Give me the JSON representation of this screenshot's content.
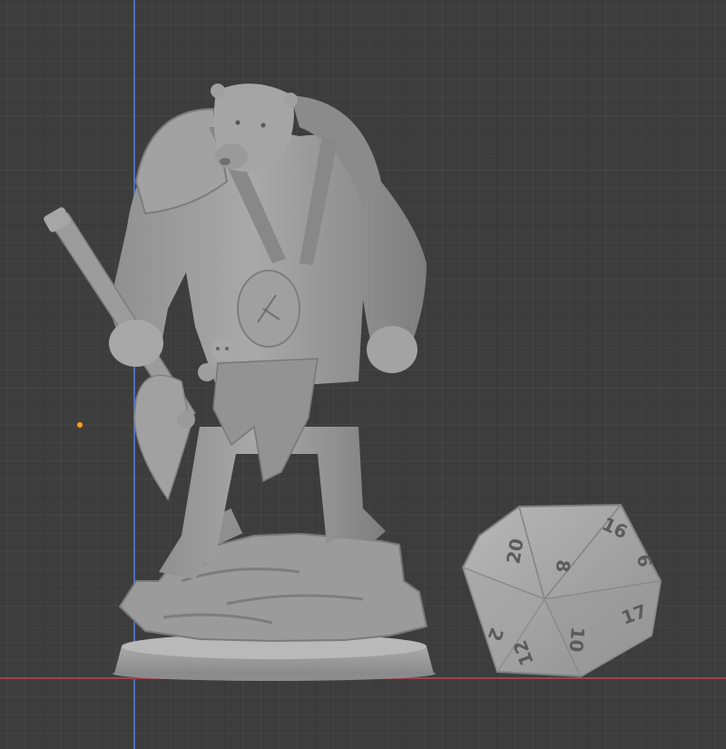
{
  "viewport": {
    "background_color": "#3d3d3d",
    "x_axis_color": "#a3404e",
    "y_axis_color": "#4a6fbd",
    "origin_color": "#f0a030"
  },
  "objects": [
    {
      "name": "bear-warrior-miniature",
      "color": "#9a9a9a"
    },
    {
      "name": "d20-die",
      "color": "#a7a7a7"
    }
  ],
  "d20": {
    "faces": [
      "20",
      "8",
      "16",
      "17",
      "10",
      "12",
      "2",
      "6"
    ]
  }
}
